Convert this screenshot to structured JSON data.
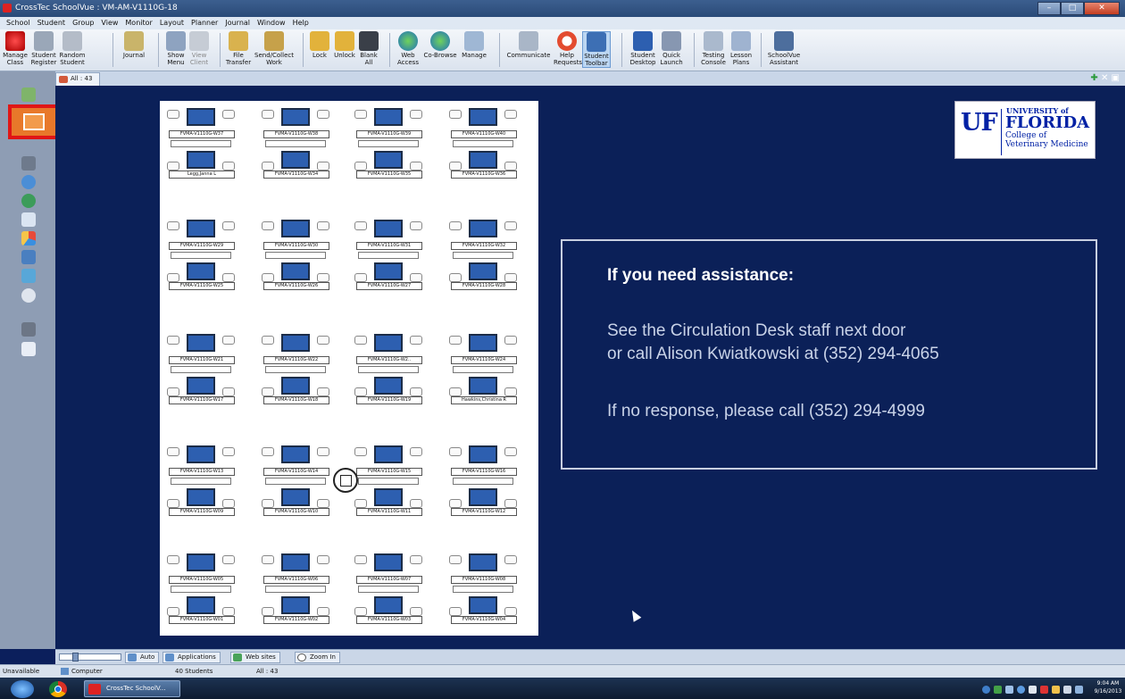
{
  "window": {
    "title": "CrossTec SchoolVue : VM-AM-V1110G-18"
  },
  "menu": [
    "School",
    "Student",
    "Group",
    "View",
    "Monitor",
    "Layout",
    "Planner",
    "Journal",
    "Window",
    "Help"
  ],
  "toolbar": [
    {
      "label": "Manage\nClass"
    },
    {
      "label": "Student\nRegister"
    },
    {
      "label": "Random\nStudent"
    },
    {
      "label": "Journal"
    },
    {
      "label": "Show\nMenu"
    },
    {
      "label": "View\nClient"
    },
    {
      "label": "File\nTransfer"
    },
    {
      "label": "Send/Collect\nWork"
    },
    {
      "label": "Lock"
    },
    {
      "label": "Unlock"
    },
    {
      "label": "Blank\nAll"
    },
    {
      "label": "Web\nAccess"
    },
    {
      "label": "Co-Browse"
    },
    {
      "label": "Manage"
    },
    {
      "label": "Communicate"
    },
    {
      "label": "Help\nRequests"
    },
    {
      "label": "Student\nToolbar"
    },
    {
      "label": "Student\nDesktop"
    },
    {
      "label": "Quick\nLaunch"
    },
    {
      "label": "Testing\nConsole"
    },
    {
      "label": "Lesson\nPlans"
    },
    {
      "label": "SchoolVue\nAssistant"
    }
  ],
  "tab": {
    "label": "All : 43"
  },
  "desks": [
    {
      "top": "FVMA-V1110G-W37",
      "bottom": "Legg,Janna L"
    },
    {
      "top": "FVMA-V1110G-W38",
      "bottom": "FVMA-V1110G-W34"
    },
    {
      "top": "FVMA-V1110G-W39",
      "bottom": "FVMA-V1110G-W35"
    },
    {
      "top": "FVMA-V1110G-W40",
      "bottom": "FVMA-V1110G-W36"
    },
    {
      "top": "FVMA-V1110G-W29",
      "bottom": "FVMA-V1110G-W25"
    },
    {
      "top": "FVMA-V1110G-W30",
      "bottom": "FVMA-V1110G-W26"
    },
    {
      "top": "FVMA-V1110G-W31",
      "bottom": "FVMA-V1110G-W27"
    },
    {
      "top": "FVMA-V1110G-W32",
      "bottom": "FVMA-V1110G-W28"
    },
    {
      "top": "FVMA-V1110G-W21",
      "bottom": "FVMA-V1110G-W17"
    },
    {
      "top": "FVMA-V1110G-W22",
      "bottom": "FVMA-V1110G-W18"
    },
    {
      "top": "FVMA-V1110G-W2..",
      "bottom": "FVMA-V1110G-W19"
    },
    {
      "top": "FVMA-V1110G-W24",
      "bottom": "Hawkins,Christina R"
    },
    {
      "top": "FVMA-V1110G-W13",
      "bottom": "FVMA-V1110G-W09"
    },
    {
      "top": "FVMA-V1110G-W14",
      "bottom": "FVMA-V1110G-W10"
    },
    {
      "top": "FVMA-V1110G-W15",
      "bottom": "FVMA-V1110G-W11"
    },
    {
      "top": "FVMA-V1110G-W16",
      "bottom": "FVMA-V1110G-W12"
    },
    {
      "top": "FVMA-V1110G-W05",
      "bottom": "FVMA-V1110G-W01"
    },
    {
      "top": "FVMA-V1110G-W06",
      "bottom": "FVMA-V1110G-W02"
    },
    {
      "top": "FVMA-V1110G-W07",
      "bottom": "FVMA-V1110G-W03"
    },
    {
      "top": "FVMA-V1110G-W08",
      "bottom": "FVMA-V1110G-W04"
    }
  ],
  "logo": {
    "uf": "UF",
    "university": "UNIVERSITY of",
    "florida": "FLORIDA",
    "college1": "College of",
    "college2": "Veterinary Medicine"
  },
  "notice": {
    "heading": "If you need assistance:",
    "line1": "See the Circulation Desk staff next door",
    "line2": "or call Alison Kwiatkowski at (352) 294-4065",
    "line3": "If no response, please call (352) 294-4999"
  },
  "zoombar": {
    "auto": "Auto",
    "applications": "Applications",
    "websites": "Web sites",
    "zoomin": "Zoom In"
  },
  "status": {
    "state": "Unavailable",
    "room": "Computer Lab",
    "students": "40 Students",
    "all": "All : 43"
  },
  "taskbar": {
    "app": "CrossTec SchoolV...",
    "time": "9:04 AM",
    "date": "9/16/2013"
  },
  "colors": {
    "highlight": "#e01616",
    "arrow": "#ffe600",
    "background": "#0b2058"
  }
}
